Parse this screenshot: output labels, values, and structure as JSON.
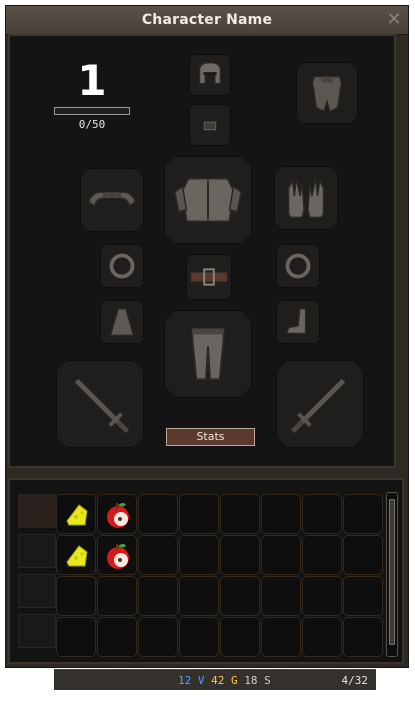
{
  "window": {
    "title": "Character Name",
    "close_glyph": "✕"
  },
  "character": {
    "level": "1",
    "xp_text": "0/50",
    "xp_progress": 0.0
  },
  "equipment": {
    "slots": [
      "head",
      "cape",
      "neck",
      "shoulders",
      "chest",
      "gloves",
      "ring-left",
      "belt",
      "ring-right",
      "back",
      "legs",
      "boots",
      "weapon-main",
      "weapon-off"
    ],
    "stats_button": "Stats"
  },
  "inventory": {
    "columns": 8,
    "rows": 4,
    "items": [
      {
        "icon": "cheese-icon",
        "name": "cheese"
      },
      {
        "icon": "apple-icon",
        "name": "apple"
      },
      {
        "icon": "cheese-icon",
        "name": "cheese"
      },
      {
        "icon": "apple-icon",
        "name": "apple"
      }
    ]
  },
  "currency": {
    "v": "12 V",
    "g": "42 G",
    "s": "18 S"
  },
  "capacity": "4/32",
  "colors": {
    "v": "#4aa3ff",
    "g": "#ffcc33",
    "s": "#cfcfcf"
  }
}
